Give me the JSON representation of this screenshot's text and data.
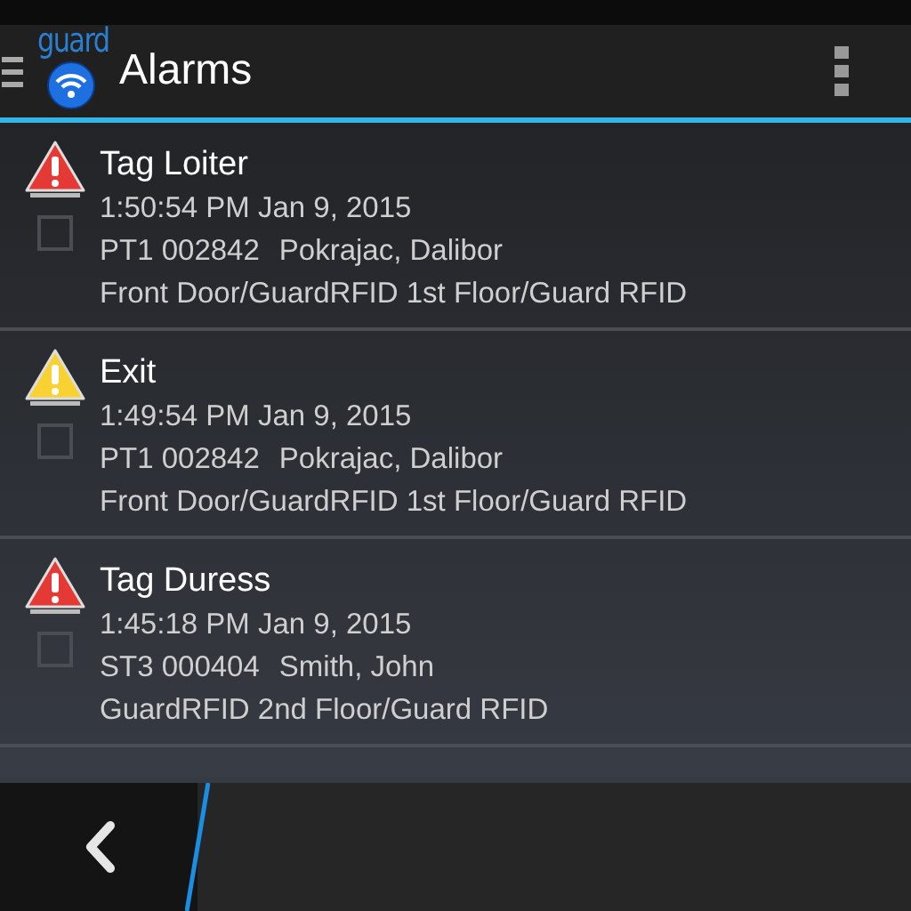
{
  "action_bar": {
    "logo_text": "guard",
    "title": "Alarms"
  },
  "alarms": [
    {
      "kind": "critical",
      "title": "Tag Loiter",
      "time": "1:50:54 PM Jan 9, 2015",
      "tag": "PT1 002842",
      "person": "Pokrajac, Dalibor",
      "location": "Front Door/GuardRFID 1st Floor/Guard RFID",
      "checked": false
    },
    {
      "kind": "warning",
      "title": "Exit",
      "time": "1:49:54 PM Jan 9, 2015",
      "tag": "PT1 002842",
      "person": "Pokrajac, Dalibor",
      "location": "Front Door/GuardRFID 1st Floor/Guard RFID",
      "checked": false
    },
    {
      "kind": "critical",
      "title": "Tag Duress",
      "time": "1:45:18 PM Jan 9, 2015",
      "tag": "ST3 000404",
      "person": "Smith, John",
      "location": "GuardRFID 2nd Floor/Guard RFID",
      "checked": false
    }
  ]
}
